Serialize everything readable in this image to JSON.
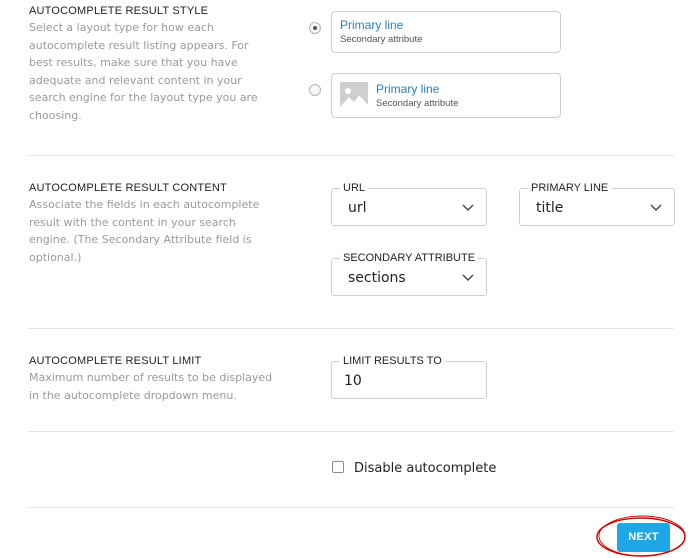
{
  "style_section": {
    "title": "AUTOCOMPLETE RESULT STYLE",
    "description": "Select a layout type for how each autocomplete result listing appears. For best results, make sure that you have adequate and relevant content in your search engine for the layout type you are choosing.",
    "options": [
      {
        "primary": "Primary line",
        "secondary": "Secondary attribute",
        "selected": true,
        "has_image": false
      },
      {
        "primary": "Primary line",
        "secondary": "Secondary attribute",
        "selected": false,
        "has_image": true
      }
    ]
  },
  "content_section": {
    "title": "AUTOCOMPLETE RESULT CONTENT",
    "description": "Associate the fields in each autocomplete result with the content in your search engine. (The Secondary Attribute field is optional.)",
    "url": {
      "label": "URL",
      "value": "url"
    },
    "primary_line": {
      "label": "PRIMARY LINE",
      "value": "title"
    },
    "secondary_attribute": {
      "label": "SECONDARY ATTRIBUTE",
      "value": "sections"
    }
  },
  "limit_section": {
    "title": "AUTOCOMPLETE RESULT LIMIT",
    "description": "Maximum number of results to be displayed in the autocomplete dropdown menu.",
    "limit": {
      "label": "LIMIT RESULTS TO",
      "value": "10"
    }
  },
  "disable": {
    "label": "Disable autocomplete",
    "checked": false
  },
  "next_label": "NEXT",
  "colors": {
    "accent": "#1ea6e6",
    "link": "#2a7fc0",
    "annotation": "#cc0000"
  }
}
